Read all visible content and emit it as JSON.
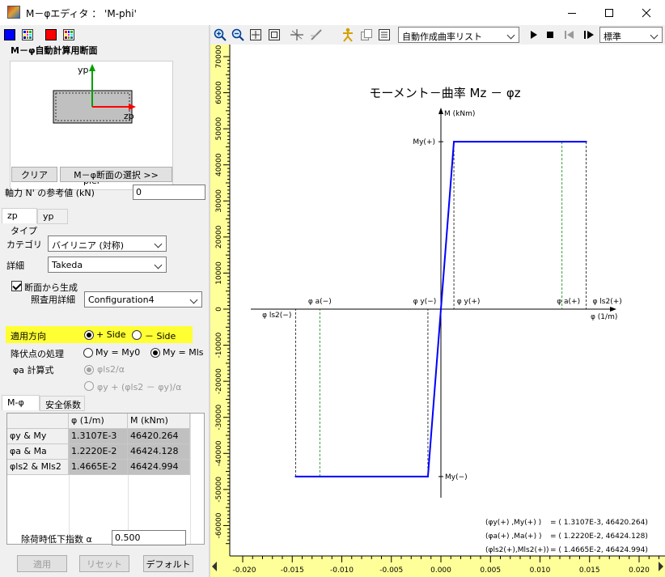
{
  "window": {
    "title": "M－φエディタ ： 'M-phi'"
  },
  "colors": {
    "series": "#0000ff",
    "ruler": "#ffff99",
    "highlight": "#ffff33",
    "annotation_green": "#008000"
  },
  "left_panel": {
    "section_title": "M－φ自動計算用断面",
    "preview": {
      "yp_label": "yp",
      "zp_label": "zp",
      "section_name": "pier"
    },
    "clear_button": "クリア",
    "select_button": "M－φ断面の選択 >>",
    "axial_label": "軸力 N' の参考値 (kN)",
    "axial_value": "0",
    "tabs": [
      "zp",
      "yp"
    ],
    "type_group": "タイプ",
    "category_label": "カテゴリ",
    "category_value": "バイリニア (対称)",
    "detail_label": "詳細",
    "detail_value": "Takeda",
    "generate_label": "断面から生成",
    "reference_label": "照査用詳細",
    "reference_value": "Configuration4",
    "direction_label": "適用方向",
    "direction_plus": "+ Side",
    "direction_minus": "－ Side",
    "yield_label": "降伏点の処理",
    "yield_opt1": "My = My0",
    "yield_opt2": "My = Mls",
    "phia_label": "φa 計算式",
    "phia_opt1": "φls2/α",
    "phia_opt2": "φy + (φls2 － φy)/α",
    "lower_tabs": [
      "M-φ",
      "安全係数"
    ],
    "table": {
      "headers": [
        "",
        "φ (1/m)",
        "M (kNm)"
      ],
      "rows": [
        [
          "φy & My",
          "1.3107E-3",
          "46420.264"
        ],
        [
          "φa & Ma",
          "1.2220E-2",
          "46424.128"
        ],
        [
          "φls2 & Mls2",
          "1.4665E-2",
          "46424.994"
        ]
      ]
    },
    "unload_label": "除荷時低下指数 α",
    "unload_value": "0.500",
    "apply_button": "適用",
    "reset_button": "リセット",
    "default_button": "デフォルト"
  },
  "toolbar": {
    "curve_list": "自動作成曲率リスト",
    "view_mode": "標準",
    "icons": [
      "zoom-in-icon",
      "zoom-out-icon",
      "zoom-fit-icon",
      "zoom-window-icon",
      "crosshair-icon",
      "pen-icon",
      "person-icon",
      "copy-icon",
      "list-icon",
      "play-icon",
      "stop-icon",
      "step-back-icon",
      "step-forward-icon"
    ]
  },
  "chart_data": {
    "type": "line",
    "title": "モーメント－曲率 Mz － φz",
    "xlabel": "φ (1/m)",
    "ylabel": "M (kNm)",
    "xlim": [
      -0.02,
      0.02
    ],
    "ylim": [
      -70000,
      70000
    ],
    "x_ticks": [
      "-0.020",
      "-0.015",
      "-0.010",
      "-0.005",
      "0.000",
      "0.005",
      "0.010",
      "0.015",
      "0.020"
    ],
    "y_ticks": [
      "70000",
      "60000",
      "50000",
      "40000",
      "30000",
      "20000",
      "10000",
      "0",
      "-10000",
      "-20000",
      "-30000",
      "-40000",
      "-50000",
      "-60000"
    ],
    "series": [
      {
        "x": [
          -0.014665,
          -0.0013107,
          0.0013107,
          0.014665
        ],
        "y": [
          -46424.994,
          -46420.264,
          46420.264,
          46424.994
        ]
      }
    ],
    "markers": {
      "phi_y": 0.0013107,
      "phi_a": 0.01222,
      "phi_ls2": 0.014665,
      "my": 46420.264
    },
    "annotations": {
      "my_pos": "My(+)",
      "my_neg": "My(−)",
      "phiy_neg": "φ y(−)",
      "phiy_pos": "φ y(+)",
      "phia_neg": "φ a(−)",
      "phia_pos": "φ a(+)",
      "phils2_neg": "φ ls2(−)",
      "phils2_pos": "φ ls2(+)"
    },
    "info_lines": [
      {
        "left": "(φy(+) ,My(+) )",
        "right": "= ( 1.3107E-3,  46420.264)"
      },
      {
        "left": "(φa(+) ,Ma(+) )",
        "right": "= ( 1.2220E-2,  46424.128)"
      },
      {
        "left": "(φls2(+),Mls2(+))",
        "right": "= ( 1.4665E-2,  46424.994)"
      }
    ]
  }
}
